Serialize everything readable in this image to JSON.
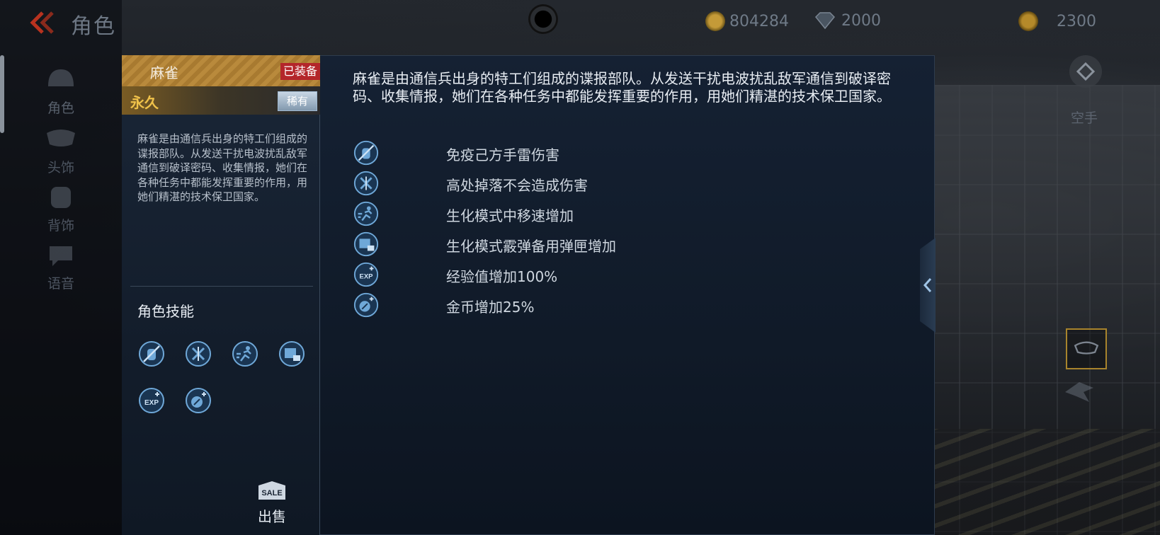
{
  "header": {
    "title": "角色",
    "currencies": [
      {
        "name": "gold-bars",
        "value": "804284"
      },
      {
        "name": "diamonds",
        "value": "2000"
      },
      {
        "name": "coins",
        "value": "2300"
      }
    ]
  },
  "nav": {
    "items": [
      {
        "label": "角色",
        "icon": "helmet-icon",
        "active": true
      },
      {
        "label": "头饰",
        "icon": "mask-icon",
        "active": false
      },
      {
        "label": "背饰",
        "icon": "backpack-icon",
        "active": false
      },
      {
        "label": "语音",
        "icon": "chat-icon",
        "active": false
      }
    ]
  },
  "right_bar": {
    "weapon_label": "空手"
  },
  "card": {
    "name": "麻雀",
    "equipped": "已装备",
    "duration": "永久",
    "rarity": "稀有",
    "description": "麻雀是由通信兵出身的特工们组成的谍报部队。从发送干扰电波扰乱敌军通信到破译密码、收集情报，她们在各种任务中都能发挥重要的作用，用她们精湛的技术保卫国家。",
    "skills_title": "角色技能",
    "sale_tag": "SALE",
    "sale_label": "出售"
  },
  "detail": {
    "description": "麻雀是由通信兵出身的特工们组成的谍报部队。从发送干扰电波扰乱敌军通信到破译密码、收集情报，她们在各种任务中都能发挥重要的作用，用她们精湛的技术保卫国家。",
    "features": [
      {
        "icon": "grenade-immune-icon",
        "text": "免疫己方手雷伤害"
      },
      {
        "icon": "no-fall-damage-icon",
        "text": "高处掉落不会造成伤害"
      },
      {
        "icon": "run-speed-icon",
        "text": "生化模式中移速增加"
      },
      {
        "icon": "ammo-clip-icon",
        "text": "生化模式霰弹备用弹匣增加"
      },
      {
        "icon": "exp-boost-icon",
        "text": "经验值增加100%"
      },
      {
        "icon": "coin-boost-icon",
        "text": "金币增加25%"
      }
    ]
  },
  "colors": {
    "accent_gold": "#b98a3c",
    "equipped_red": "#b4262a",
    "duration_yellow": "#f0c24a",
    "icon_blue": "#6fa8d8"
  }
}
